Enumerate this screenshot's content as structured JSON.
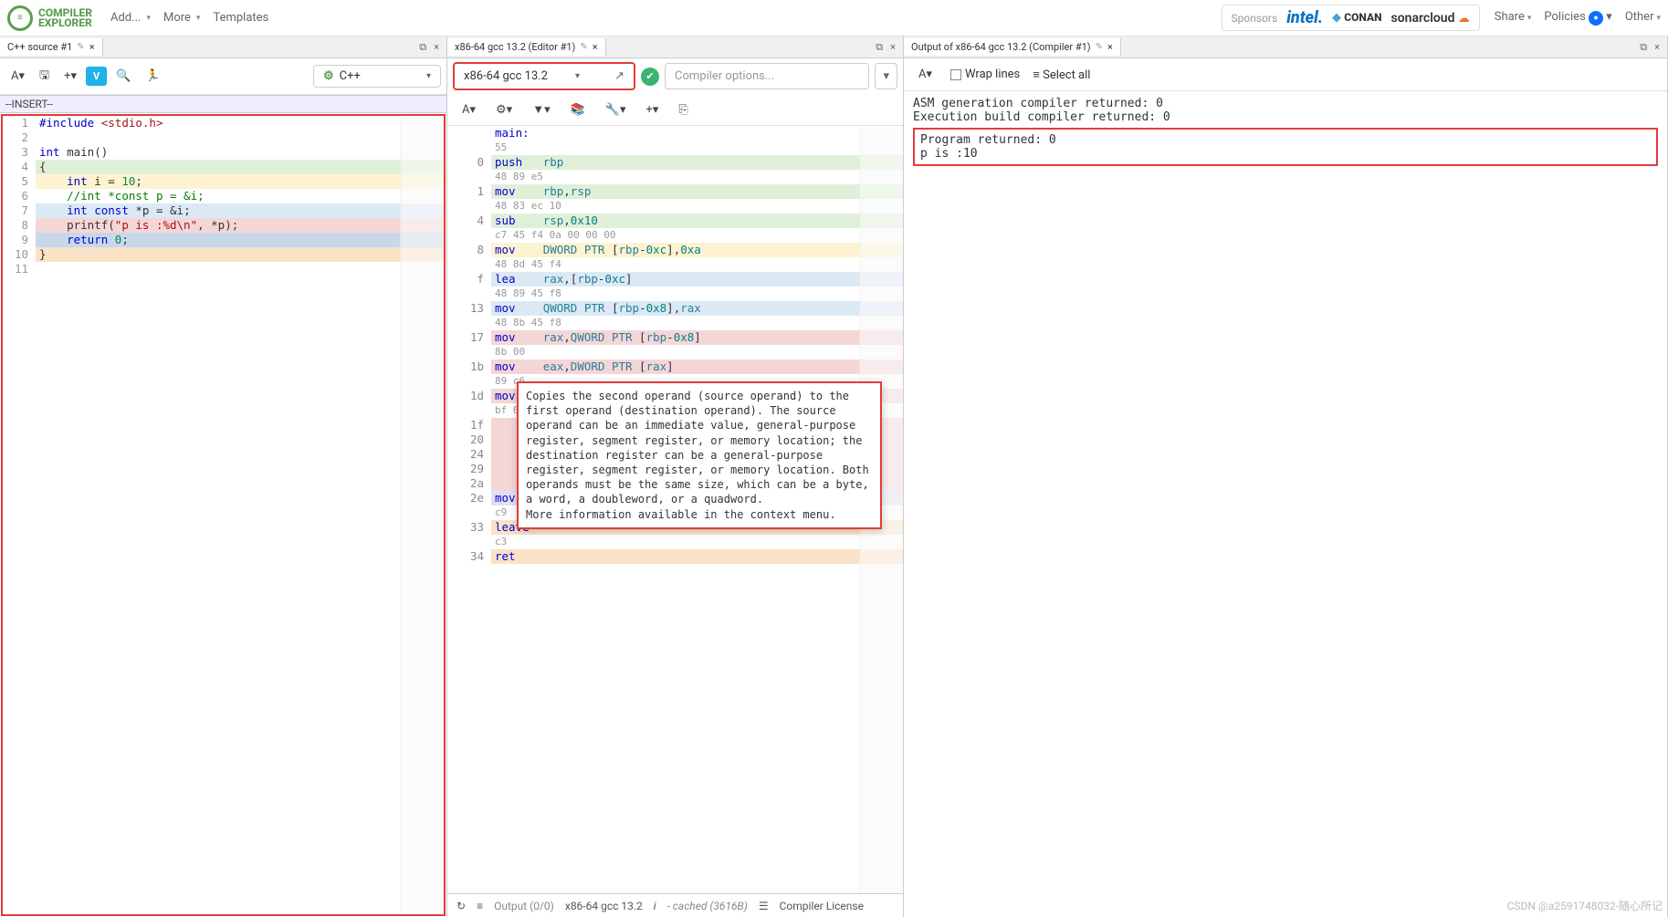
{
  "top": {
    "logo1": "COMPILER",
    "logo2": "EXPLORER",
    "menu": [
      "Add...",
      "More",
      "Templates"
    ],
    "sponsors_label": "Sponsors",
    "intel": "intel.",
    "conan": "CONAN",
    "sonar": "sonarcloud",
    "rightmenu": [
      "Share",
      "Policies",
      "Other"
    ]
  },
  "src": {
    "tab": "C++ source #1",
    "vimmode": "--INSERT--",
    "lang": "C++",
    "lines": [
      {
        "n": "1",
        "cls": "",
        "html": "<span class='kw-pp'>#include</span> <span class='kw-str'>&lt;stdio.h&gt;</span>"
      },
      {
        "n": "2",
        "cls": "",
        "html": ""
      },
      {
        "n": "3",
        "cls": "",
        "html": "<span class='kw-type'>int</span> main()"
      },
      {
        "n": "4",
        "cls": "hl-green",
        "html": "{"
      },
      {
        "n": "5",
        "cls": "hl-yellow",
        "html": "    <span class='kw-type'>int</span> i = <span class='kw-num'>10</span>;"
      },
      {
        "n": "6",
        "cls": "",
        "html": "    <span class='kw-cmt'>//int *const p = &amp;i;</span>"
      },
      {
        "n": "7",
        "cls": "hl-blue",
        "html": "    <span class='kw-type'>int</span> <span class='kw-type'>const</span> *p = &amp;i;"
      },
      {
        "n": "8",
        "cls": "hl-pink",
        "html": "    printf(<span class='kw-str'>\"p is :%d\\n\"</span>, *p);"
      },
      {
        "n": "9",
        "cls": "hl-cursor",
        "html": "    <span class='kw-ret'>return</span> <span class='kw-num'>0</span>;"
      },
      {
        "n": "10",
        "cls": "hl-orange",
        "html": "}"
      },
      {
        "n": "11",
        "cls": "",
        "html": ""
      }
    ]
  },
  "asm": {
    "tab": "x86-64 gcc 13.2 (Editor #1)",
    "compiler": "x86-64 gcc 13.2",
    "options_placeholder": "Compiler options...",
    "lines": [
      {
        "off": "",
        "cls": "",
        "asm": "<span class='kw-lbl'>main:</span>",
        "bytes": "55"
      },
      {
        "off": "0",
        "cls": "hl-green",
        "asm": "<span class='kw-op'>push</span>   <span class='kw-reg'>rbp</span>",
        "bytes": "48 89 e5"
      },
      {
        "off": "1",
        "cls": "hl-green",
        "asm": "<span class='kw-op'>mov</span>    <span class='kw-reg'>rbp</span>,<span class='kw-reg'>rsp</span>",
        "bytes": "48 83 ec 10"
      },
      {
        "off": "4",
        "cls": "hl-green",
        "asm": "<span class='kw-op'>sub</span>    <span class='kw-reg'>rsp</span>,<span class='kw-imm'>0x10</span>",
        "bytes": "c7 45 f4 0a 00 00 00"
      },
      {
        "off": "8",
        "cls": "hl-yellow",
        "asm": "<span class='kw-op'>mov</span>    <span class='kw-addr'>DWORD PTR</span> [<span class='kw-reg'>rbp</span>-<span class='kw-imm'>0xc</span>],<span class='kw-imm'>0xa</span>",
        "bytes": "48 8d 45 f4"
      },
      {
        "off": "f",
        "cls": "hl-blue",
        "asm": "<span class='kw-op'>lea</span>    <span class='kw-reg'>rax</span>,[<span class='kw-reg'>rbp</span>-<span class='kw-imm'>0xc</span>]",
        "bytes": "48 89 45 f8"
      },
      {
        "off": "13",
        "cls": "hl-blue",
        "asm": "<span class='kw-op'>mov</span>    <span class='kw-addr'>QWORD PTR</span> [<span class='kw-reg'>rbp</span>-<span class='kw-imm'>0x8</span>],<span class='kw-reg'>rax</span>",
        "bytes": "48 8b 45 f8"
      },
      {
        "off": "17",
        "cls": "hl-pink",
        "asm": "<span class='kw-op'>mov</span>    <span class='kw-reg'>rax</span>,<span class='kw-addr'>QWORD PTR</span> [<span class='kw-reg'>rbp</span>-<span class='kw-imm'>0x8</span>]",
        "bytes": "8b 00"
      },
      {
        "off": "1b",
        "cls": "hl-pink",
        "asm": "<span class='kw-op'>mov</span>    <span class='kw-reg'>eax</span>,<span class='kw-addr'>DWORD PTR</span> [<span class='kw-reg'>rax</span>]",
        "bytes": "89 c6"
      },
      {
        "off": "1d",
        "cls": "hl-pink",
        "asm": "<span class='kw-op'>mov</span>    <span class='kw-reg'>esi</span>,<span class='kw-reg'>eax</span>",
        "bytes": "bf 00 00 00 00"
      },
      {
        "off": "1f",
        "cls": "hl-pink",
        "asm": "",
        "bytes": ""
      },
      {
        "off": "20",
        "cls": "hl-pink",
        "asm": "",
        "bytes": ""
      },
      {
        "off": "24",
        "cls": "hl-pink",
        "asm": "",
        "bytes": ""
      },
      {
        "off": "29",
        "cls": "hl-pink",
        "asm": "",
        "bytes": ""
      },
      {
        "off": "2a",
        "cls": "hl-pink",
        "asm": "",
        "bytes": ""
      },
      {
        "off": "2e",
        "cls": "hl-lav",
        "asm": "<span class='kw-op'>mov</span>    <span class='kw-reg'>eax</span>,<span class='kw-imm'>0x0</span>",
        "bytes": "c9"
      },
      {
        "off": "33",
        "cls": "hl-orange",
        "asm": "<span class='kw-op'>leave</span>",
        "bytes": "c3"
      },
      {
        "off": "34",
        "cls": "hl-orange",
        "asm": "<span class='kw-op'>ret</span>",
        "bytes": ""
      }
    ],
    "tooltip": "Copies the second operand (source operand) to the first operand (destination operand). The source operand can be an immediate value, general-purpose register, segment register, or memory location; the destination register can be a general-purpose register, segment register, or memory location. Both operands must be the same size, which can be a byte, a word, a doubleword, or a quadword.",
    "tooltip_more": "More information available in the context menu.",
    "status": {
      "output": "Output (0/0)",
      "compiler": "x86-64 gcc 13.2",
      "cached": "- cached (3616B)",
      "license": "Compiler License"
    }
  },
  "out": {
    "tab": "Output of x86-64 gcc 13.2 (Compiler #1)",
    "wrap": "Wrap lines",
    "selectall": "Select all",
    "lines": [
      "ASM generation compiler returned: 0",
      "Execution build compiler returned: 0"
    ],
    "redlines": [
      "Program returned: 0",
      " p is :10"
    ]
  },
  "watermark": "CSDN @a2591748032-随心所记"
}
